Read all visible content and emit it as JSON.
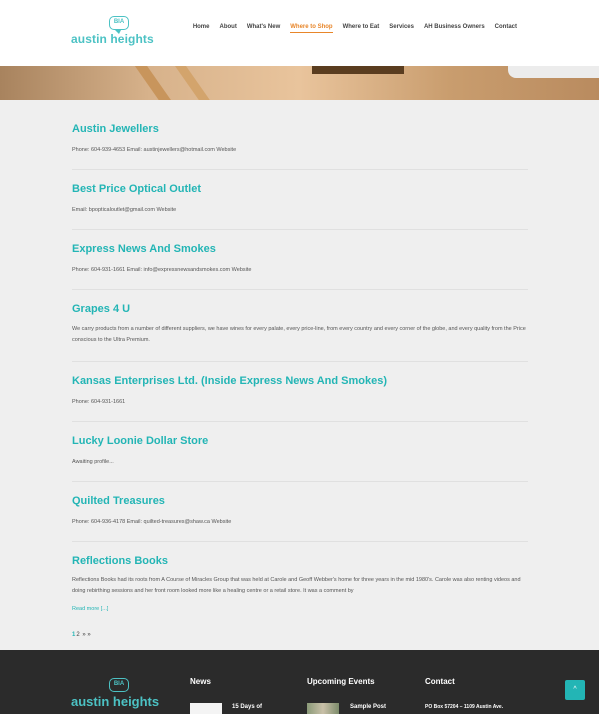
{
  "header": {
    "logo_badge": "BIA",
    "logo_text": "austin heights",
    "nav": [
      {
        "label": "Home",
        "active": false
      },
      {
        "label": "About",
        "active": false
      },
      {
        "label": "What's New",
        "active": false
      },
      {
        "label": "Where to Shop",
        "active": true
      },
      {
        "label": "Where to Eat",
        "active": false
      },
      {
        "label": "Services",
        "active": false
      },
      {
        "label": "AH Business Owners",
        "active": false
      },
      {
        "label": "Contact",
        "active": false
      }
    ]
  },
  "listings": [
    {
      "title": "Austin Jewellers",
      "details": "Phone: 604-939-4653 Email: austinjewellers@hotmail.com Website"
    },
    {
      "title": "Best Price Optical Outlet",
      "details": "Email: bpopticaloutlet@gmail.com Website"
    },
    {
      "title": "Express News And Smokes",
      "details": "Phone: 604-931-1661 Email: info@expressnewsandsmokes.com Website"
    },
    {
      "title": "Grapes 4 U",
      "details": "We carry products from a number of different suppliers, we have wines for every palate, every price-line, from every country and every corner of the globe, and every quality from the Price conscious to the Ultra Premium."
    },
    {
      "title": "Kansas Enterprises Ltd. (Inside Express News And Smokes)",
      "details": "Phone: 604-931-1661"
    },
    {
      "title": "Lucky Loonie Dollar Store",
      "details": "Awaiting profile..."
    },
    {
      "title": "Quilted Treasures",
      "details": "Phone: 604-936-4178 Email: quilted-treasures@shaw.ca Website"
    },
    {
      "title": "Reflections Books",
      "details": "Reflections Books had its roots from A Course of Miracles Group that was held at Carole and Geoff Webber's home for three years in the mid 1980's. Carole was also renting videos and doing rebirthing sessions and her front room looked more like a healing centre or a retail store. It was a comment by",
      "more": "Read more [...]"
    }
  ],
  "pagination": {
    "current": "1",
    "next": "2",
    "arrow": "» »"
  },
  "footer": {
    "logo_badge": "BIA",
    "logo_text": "austin heights",
    "news_heading": "News",
    "news_item": "15 Days of",
    "events_heading": "Upcoming Events",
    "events_item": "Sample Post",
    "contact_heading": "Contact",
    "contact_line": "PO Box 57204 – 1109 Austin Ave.",
    "scroll_top": "^"
  },
  "colors": {
    "accent": "#23b5b5",
    "active_nav": "#e8862a",
    "footer_bg": "#2b2b2b"
  }
}
